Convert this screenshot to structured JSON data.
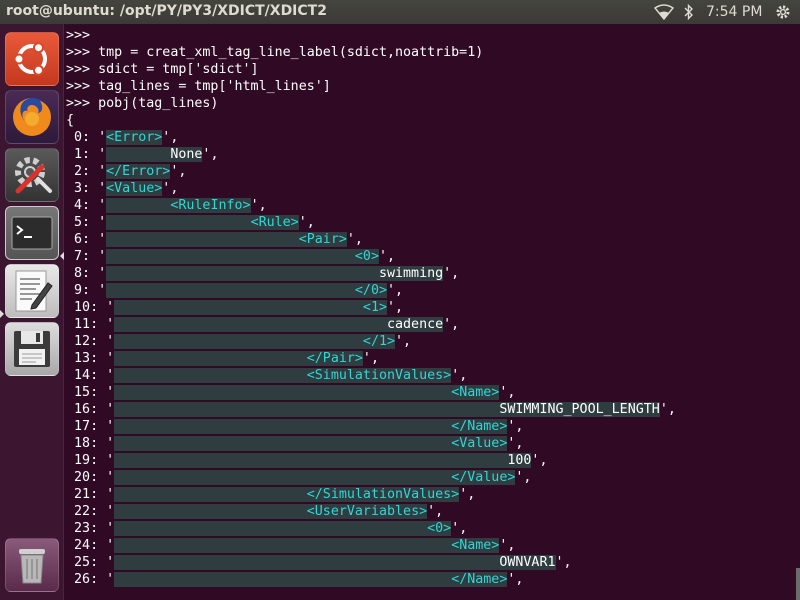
{
  "window": {
    "title": "root@ubuntu: /opt/PY/PY3/XDICT/XDICT2"
  },
  "tray": {
    "clock": "7:54 PM",
    "icons": [
      "wifi-icon",
      "bluetooth-icon",
      "settings-gear-icon"
    ]
  },
  "launcher": {
    "items": [
      {
        "name": "ubuntu-dash",
        "icon": "ubuntu-logo-icon"
      },
      {
        "name": "firefox",
        "icon": "firefox-icon"
      },
      {
        "name": "system-settings",
        "icon": "settings-icon"
      },
      {
        "name": "terminal",
        "icon": "terminal-icon"
      },
      {
        "name": "text-editor",
        "icon": "text-editor-icon"
      },
      {
        "name": "save",
        "icon": "floppy-disk-icon"
      },
      {
        "name": "trash",
        "icon": "trash-icon"
      }
    ]
  },
  "colors": {
    "terminal_bg": "#300a24",
    "tag_color": "#2fd7d7",
    "highlight_bg": "#2f3c40",
    "launcher_bg": "#3c1530"
  },
  "terminal": {
    "lines": [
      ">>>",
      ">>> tmp = creat_xml_tag_line_label(sdict,noattrib=1)",
      ">>> sdict = tmp['sdict']",
      ">>> tag_lines = tmp['html_lines']",
      ">>> pobj(tag_lines)",
      "{",
      " 0: '<Error>',",
      " 1: '        None',",
      " 2: '</Error>',",
      " 3: '<Value>',",
      " 4: '        <RuleInfo>',",
      " 5: '                  <Rule>',",
      " 6: '                        <Pair>',",
      " 7: '                               <0>',",
      " 8: '                                  swimming',",
      " 9: '                               </0>',",
      " 10: '                               <1>',",
      " 11: '                                  cadence',",
      " 12: '                               </1>',",
      " 13: '                        </Pair>',",
      " 14: '                        <SimulationValues>',",
      " 15: '                                          <Name>',",
      " 16: '                                                SWIMMING_POOL_LENGTH',",
      " 17: '                                          </Name>',",
      " 18: '                                          <Value>',",
      " 19: '                                                 100',",
      " 20: '                                          </Value>',",
      " 21: '                        </SimulationValues>',",
      " 22: '                        <UserVariables>',",
      " 23: '                                       <0>',",
      " 24: '                                          <Name>',",
      " 25: '                                                OWNVAR1',",
      " 26: '                                          </Name>',"
    ]
  }
}
